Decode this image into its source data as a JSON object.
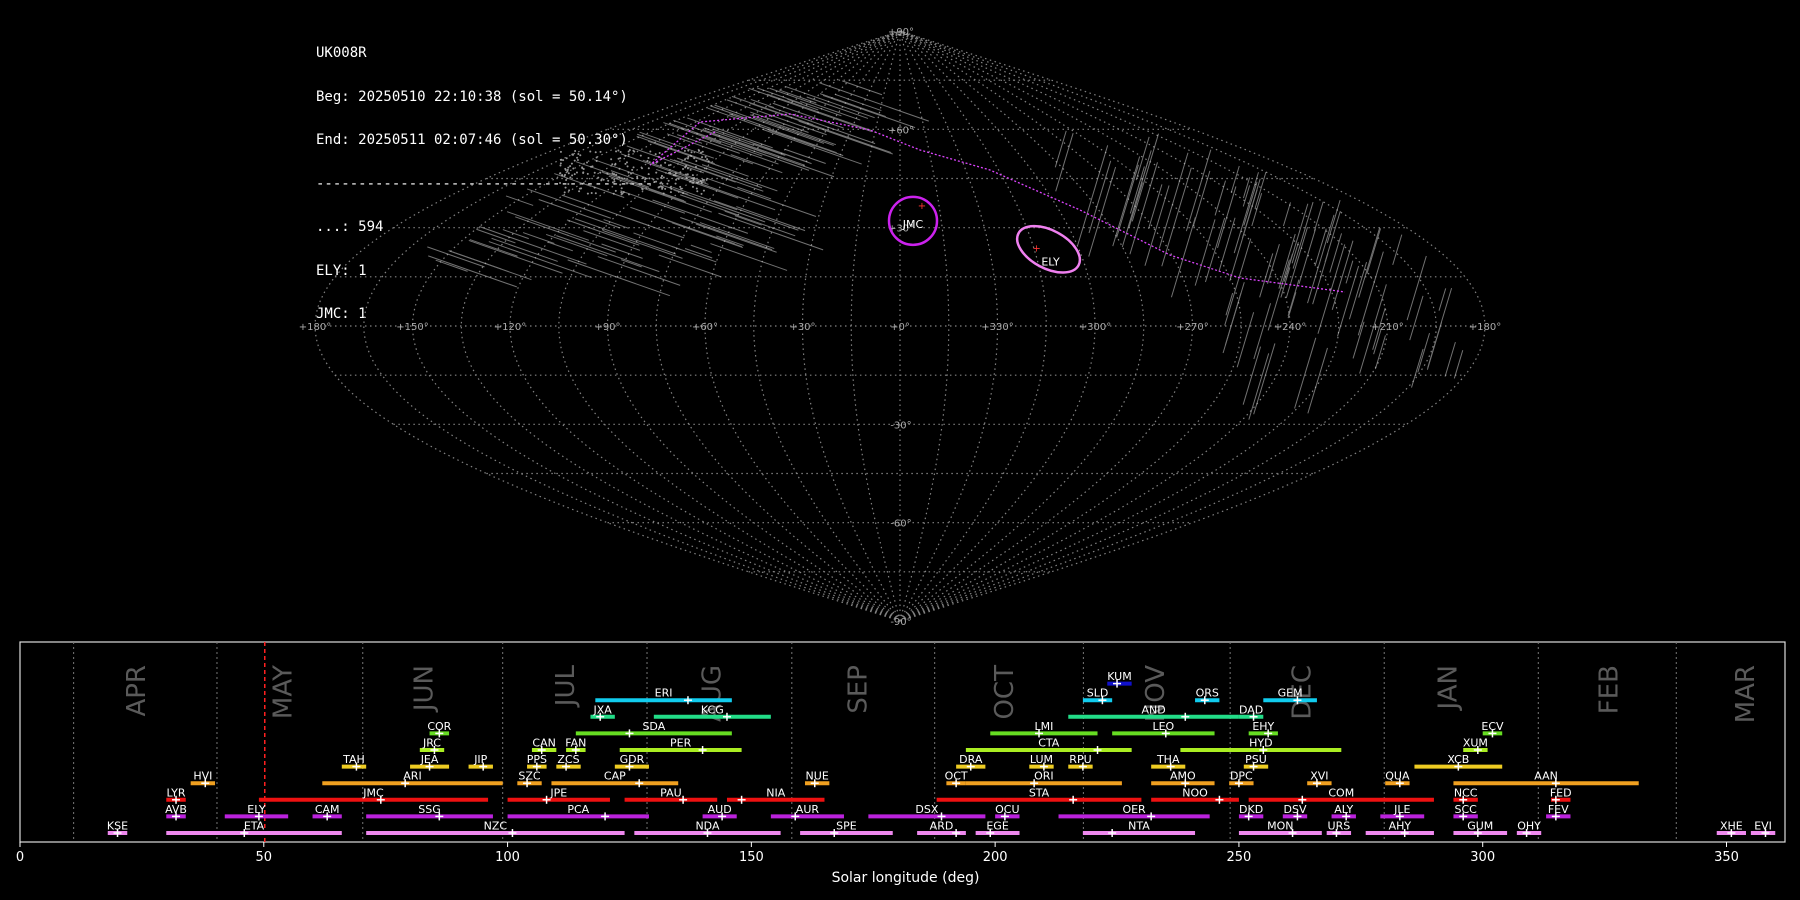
{
  "header": {
    "station": "UK008R",
    "beg": "Beg: 20250510 22:10:38 (sol = 50.14°)",
    "end": "End: 20250511 02:07:46 (sol = 50.30°)",
    "separator": "----------------------------------------",
    "counts": [
      "...: 594",
      "ELY: 1",
      "JMC: 1"
    ]
  },
  "colors": {
    "background": "#000000",
    "grid": "#9a9a9a",
    "month_label": "#5a5a5a",
    "current_sol": "#ff2020",
    "orbit_track": "#dd44ff",
    "jmc_circle": "#cc22ee",
    "ely_ellipse": "#f080f0"
  },
  "sky_map": {
    "projection": "sinusoidal",
    "meridian_labels": [
      "+180°",
      "+150°",
      "+120°",
      "+90°",
      "+60°",
      "+30°",
      "+0°",
      "+330°",
      "+300°",
      "+270°",
      "+240°",
      "+210°",
      "+180°"
    ],
    "parallel_labels": [
      "+90°",
      "+60°",
      "+30°",
      "-30°",
      "-60°",
      "-90°"
    ],
    "showers": [
      {
        "code": "JMC",
        "lon": 0,
        "lat": 33
      },
      {
        "code": "ELY",
        "lon": -48,
        "lat": 24
      }
    ]
  },
  "chart_data": {
    "type": "timeline",
    "xlabel": "Solar longitude (deg)",
    "xlim": [
      0,
      362
    ],
    "xticks": [
      0,
      50,
      100,
      150,
      200,
      250,
      300,
      350
    ],
    "current_sol": 50.2,
    "months": [
      {
        "name": "APR",
        "start": 11.0,
        "label_at": 24
      },
      {
        "name": "MAY",
        "start": 40.4,
        "label_at": 54
      },
      {
        "name": "JUN",
        "start": 70.3,
        "label_at": 83
      },
      {
        "name": "JUL",
        "start": 99.0,
        "label_at": 112
      },
      {
        "name": "AUG",
        "start": 128.6,
        "label_at": 142
      },
      {
        "name": "SEP",
        "start": 158.3,
        "label_at": 172
      },
      {
        "name": "OCT",
        "start": 187.6,
        "label_at": 202
      },
      {
        "name": "NOV",
        "start": 218.1,
        "label_at": 233
      },
      {
        "name": "DEC",
        "start": 248.2,
        "label_at": 263
      },
      {
        "name": "JAN",
        "start": 279.8,
        "label_at": 293
      },
      {
        "name": "FEB",
        "start": 311.4,
        "label_at": 326
      },
      {
        "name": "MAR",
        "start": 339.7,
        "label_at": 354
      }
    ],
    "showers": [
      {
        "code": "KUM",
        "row": 9,
        "start": 223,
        "end": 228,
        "peak": 225,
        "color": "#1010cc"
      },
      {
        "code": "ERI",
        "row": 8,
        "start": 118,
        "end": 146,
        "peak": 137,
        "color": "#11ccee"
      },
      {
        "code": "SLD",
        "row": 8,
        "start": 218,
        "end": 224,
        "peak": 222,
        "color": "#11ccee"
      },
      {
        "code": "ORS",
        "row": 8,
        "start": 241,
        "end": 246,
        "peak": 243,
        "color": "#11ccee"
      },
      {
        "code": "GEM",
        "row": 8,
        "start": 255,
        "end": 266,
        "peak": 262,
        "color": "#11ccee"
      },
      {
        "code": "JXA",
        "row": 7,
        "start": 117,
        "end": 122,
        "peak": 119,
        "color": "#22dd88"
      },
      {
        "code": "KCG",
        "row": 7,
        "start": 130,
        "end": 154,
        "peak": 145,
        "color": "#22dd88"
      },
      {
        "code": "AND",
        "row": 7,
        "start": 215,
        "end": 250,
        "peak": 239,
        "color": "#22dd88"
      },
      {
        "code": "DAD",
        "row": 7,
        "start": 250,
        "end": 255,
        "peak": 253,
        "color": "#22dd88"
      },
      {
        "code": "COR",
        "row": 6,
        "start": 84,
        "end": 88,
        "peak": 86,
        "color": "#66dd22"
      },
      {
        "code": "SDA",
        "row": 6,
        "start": 114,
        "end": 146,
        "peak": 125,
        "color": "#66dd22"
      },
      {
        "code": "LMI",
        "row": 6,
        "start": 199,
        "end": 221,
        "peak": 209,
        "color": "#66dd22"
      },
      {
        "code": "LEO",
        "row": 6,
        "start": 224,
        "end": 245,
        "peak": 235,
        "color": "#66dd22"
      },
      {
        "code": "EHY",
        "row": 6,
        "start": 252,
        "end": 258,
        "peak": 256,
        "color": "#66dd22"
      },
      {
        "code": "ECV",
        "row": 6,
        "start": 300,
        "end": 304,
        "peak": 302,
        "color": "#66dd22"
      },
      {
        "code": "JRC",
        "row": 5,
        "start": 82,
        "end": 87,
        "peak": 85,
        "color": "#aaee22"
      },
      {
        "code": "CAN",
        "row": 5,
        "start": 105,
        "end": 110,
        "peak": 107,
        "color": "#aaee22"
      },
      {
        "code": "FAN",
        "row": 5,
        "start": 112,
        "end": 116,
        "peak": 114,
        "color": "#aaee22"
      },
      {
        "code": "PER",
        "row": 5,
        "start": 123,
        "end": 148,
        "peak": 140,
        "color": "#aaee22"
      },
      {
        "code": "CTA",
        "row": 5,
        "start": 194,
        "end": 228,
        "peak": 221,
        "color": "#aaee22"
      },
      {
        "code": "HYD",
        "row": 5,
        "start": 238,
        "end": 271,
        "peak": 255,
        "color": "#aaee22"
      },
      {
        "code": "XUM",
        "row": 5,
        "start": 296,
        "end": 301,
        "peak": 299,
        "color": "#aaee22"
      },
      {
        "code": "TAH",
        "row": 4,
        "start": 66,
        "end": 71,
        "peak": 69,
        "color": "#eecc22"
      },
      {
        "code": "JEA",
        "row": 4,
        "start": 80,
        "end": 88,
        "peak": 84,
        "color": "#eecc22"
      },
      {
        "code": "JIP",
        "row": 4,
        "start": 92,
        "end": 97,
        "peak": 95,
        "color": "#eecc22"
      },
      {
        "code": "PPS",
        "row": 4,
        "start": 104,
        "end": 108,
        "peak": 106,
        "color": "#eecc22"
      },
      {
        "code": "ZCS",
        "row": 4,
        "start": 110,
        "end": 115,
        "peak": 112,
        "color": "#eecc22"
      },
      {
        "code": "GDR",
        "row": 4,
        "start": 122,
        "end": 129,
        "peak": 125,
        "color": "#eecc22"
      },
      {
        "code": "DRA",
        "row": 4,
        "start": 192,
        "end": 198,
        "peak": 195,
        "color": "#eecc22"
      },
      {
        "code": "LUM",
        "row": 4,
        "start": 207,
        "end": 212,
        "peak": 210,
        "color": "#eecc22"
      },
      {
        "code": "RPU",
        "row": 4,
        "start": 215,
        "end": 220,
        "peak": 218,
        "color": "#eecc22"
      },
      {
        "code": "THA",
        "row": 4,
        "start": 232,
        "end": 239,
        "peak": 236,
        "color": "#eecc22"
      },
      {
        "code": "PSU",
        "row": 4,
        "start": 251,
        "end": 256,
        "peak": 253,
        "color": "#eecc22"
      },
      {
        "code": "XCB",
        "row": 4,
        "start": 286,
        "end": 304,
        "peak": 295,
        "color": "#eecc22"
      },
      {
        "code": "HVI",
        "row": 3,
        "start": 35,
        "end": 40,
        "peak": 38,
        "color": "#f0a020"
      },
      {
        "code": "ARI",
        "row": 3,
        "start": 62,
        "end": 99,
        "peak": 79,
        "color": "#f0a020"
      },
      {
        "code": "SZC",
        "row": 3,
        "start": 102,
        "end": 107,
        "peak": 104,
        "color": "#f0a020"
      },
      {
        "code": "CAP",
        "row": 3,
        "start": 109,
        "end": 135,
        "peak": 127,
        "color": "#f0a020"
      },
      {
        "code": "NUE",
        "row": 3,
        "start": 161,
        "end": 166,
        "peak": 163,
        "color": "#f0a020"
      },
      {
        "code": "OCT",
        "row": 3,
        "start": 190,
        "end": 194,
        "peak": 192,
        "color": "#f0a020"
      },
      {
        "code": "ORI",
        "row": 3,
        "start": 194,
        "end": 226,
        "peak": 208,
        "color": "#f0a020"
      },
      {
        "code": "AMO",
        "row": 3,
        "start": 232,
        "end": 245,
        "peak": 239,
        "color": "#f0a020"
      },
      {
        "code": "DPC",
        "row": 3,
        "start": 248,
        "end": 253,
        "peak": 250,
        "color": "#f0a020"
      },
      {
        "code": "XVI",
        "row": 3,
        "start": 264,
        "end": 269,
        "peak": 266,
        "color": "#f0a020"
      },
      {
        "code": "QUA",
        "row": 3,
        "start": 280,
        "end": 285,
        "peak": 283,
        "color": "#f0a020"
      },
      {
        "code": "AAN",
        "row": 3,
        "start": 294,
        "end": 332,
        "peak": 315,
        "color": "#f0a020"
      },
      {
        "code": "LYR",
        "row": 2,
        "start": 30,
        "end": 34,
        "peak": 32,
        "color": "#ee1111"
      },
      {
        "code": "JMC",
        "row": 2,
        "start": 49,
        "end": 96,
        "peak": 74,
        "color": "#ee1111"
      },
      {
        "code": "JPE",
        "row": 2,
        "start": 100,
        "end": 121,
        "peak": 108,
        "color": "#ee1111"
      },
      {
        "code": "PAU",
        "row": 2,
        "start": 124,
        "end": 143,
        "peak": 136,
        "color": "#ee1111"
      },
      {
        "code": "NIA",
        "row": 2,
        "start": 145,
        "end": 165,
        "peak": 148,
        "color": "#ee1111"
      },
      {
        "code": "STA",
        "row": 2,
        "start": 188,
        "end": 230,
        "peak": 216,
        "color": "#ee1111"
      },
      {
        "code": "NOO",
        "row": 2,
        "start": 232,
        "end": 250,
        "peak": 246,
        "color": "#ee1111"
      },
      {
        "code": "COM",
        "row": 2,
        "start": 252,
        "end": 290,
        "peak": 263,
        "color": "#ee1111"
      },
      {
        "code": "NCC",
        "row": 2,
        "start": 294,
        "end": 299,
        "peak": 296,
        "color": "#ee1111"
      },
      {
        "code": "FED",
        "row": 2,
        "start": 314,
        "end": 318,
        "peak": 315,
        "color": "#ee1111"
      },
      {
        "code": "AVB",
        "row": 1,
        "start": 30,
        "end": 34,
        "peak": 32,
        "color": "#bb22dd"
      },
      {
        "code": "ELY",
        "row": 1,
        "start": 42,
        "end": 55,
        "peak": 49,
        "color": "#bb22dd"
      },
      {
        "code": "CAM",
        "row": 1,
        "start": 60,
        "end": 66,
        "peak": 63,
        "color": "#bb22dd"
      },
      {
        "code": "SSG",
        "row": 1,
        "start": 71,
        "end": 97,
        "peak": 86,
        "color": "#bb22dd"
      },
      {
        "code": "PCA",
        "row": 1,
        "start": 100,
        "end": 129,
        "peak": 120,
        "color": "#bb22dd"
      },
      {
        "code": "AUD",
        "row": 1,
        "start": 140,
        "end": 147,
        "peak": 144,
        "color": "#bb22dd"
      },
      {
        "code": "AUR",
        "row": 1,
        "start": 154,
        "end": 169,
        "peak": 159,
        "color": "#bb22dd"
      },
      {
        "code": "DSX",
        "row": 1,
        "start": 174,
        "end": 198,
        "peak": 189,
        "color": "#bb22dd"
      },
      {
        "code": "OCU",
        "row": 1,
        "start": 200,
        "end": 205,
        "peak": 202,
        "color": "#bb22dd"
      },
      {
        "code": "OER",
        "row": 1,
        "start": 213,
        "end": 244,
        "peak": 232,
        "color": "#bb22dd"
      },
      {
        "code": "DKD",
        "row": 1,
        "start": 250,
        "end": 255,
        "peak": 252,
        "color": "#bb22dd"
      },
      {
        "code": "DSV",
        "row": 1,
        "start": 259,
        "end": 264,
        "peak": 262,
        "color": "#bb22dd"
      },
      {
        "code": "ALY",
        "row": 1,
        "start": 269,
        "end": 274,
        "peak": 272,
        "color": "#bb22dd"
      },
      {
        "code": "JLE",
        "row": 1,
        "start": 279,
        "end": 288,
        "peak": 283,
        "color": "#bb22dd"
      },
      {
        "code": "SCC",
        "row": 1,
        "start": 294,
        "end": 299,
        "peak": 296,
        "color": "#bb22dd"
      },
      {
        "code": "FEV",
        "row": 1,
        "start": 313,
        "end": 318,
        "peak": 315,
        "color": "#bb22dd"
      },
      {
        "code": "KSE",
        "row": 0,
        "start": 18,
        "end": 22,
        "peak": 20,
        "color": "#ee88ee"
      },
      {
        "code": "ETA",
        "row": 0,
        "start": 30,
        "end": 66,
        "peak": 46,
        "color": "#ee88ee"
      },
      {
        "code": "NZC",
        "row": 0,
        "start": 71,
        "end": 124,
        "peak": 101,
        "color": "#ee88ee"
      },
      {
        "code": "NDA",
        "row": 0,
        "start": 126,
        "end": 156,
        "peak": 141,
        "color": "#ee88ee"
      },
      {
        "code": "SPE",
        "row": 0,
        "start": 160,
        "end": 179,
        "peak": 167,
        "color": "#ee88ee"
      },
      {
        "code": "ARD",
        "row": 0,
        "start": 184,
        "end": 194,
        "peak": 192,
        "color": "#ee88ee"
      },
      {
        "code": "EGE",
        "row": 0,
        "start": 196,
        "end": 205,
        "peak": 199,
        "color": "#ee88ee"
      },
      {
        "code": "NTA",
        "row": 0,
        "start": 218,
        "end": 241,
        "peak": 224,
        "color": "#ee88ee"
      },
      {
        "code": "MON",
        "row": 0,
        "start": 250,
        "end": 267,
        "peak": 261,
        "color": "#ee88ee"
      },
      {
        "code": "URS",
        "row": 0,
        "start": 268,
        "end": 273,
        "peak": 270,
        "color": "#ee88ee"
      },
      {
        "code": "AHY",
        "row": 0,
        "start": 276,
        "end": 290,
        "peak": 284,
        "color": "#ee88ee"
      },
      {
        "code": "GUM",
        "row": 0,
        "start": 294,
        "end": 305,
        "peak": 299,
        "color": "#ee88ee"
      },
      {
        "code": "OHY",
        "row": 0,
        "start": 307,
        "end": 312,
        "peak": 309,
        "color": "#ee88ee"
      },
      {
        "code": "XHE",
        "row": 0,
        "start": 348,
        "end": 354,
        "peak": 351,
        "color": "#ee88ee"
      },
      {
        "code": "EVI",
        "row": 0,
        "start": 355,
        "end": 360,
        "peak": 358,
        "color": "#ee88ee"
      }
    ]
  }
}
